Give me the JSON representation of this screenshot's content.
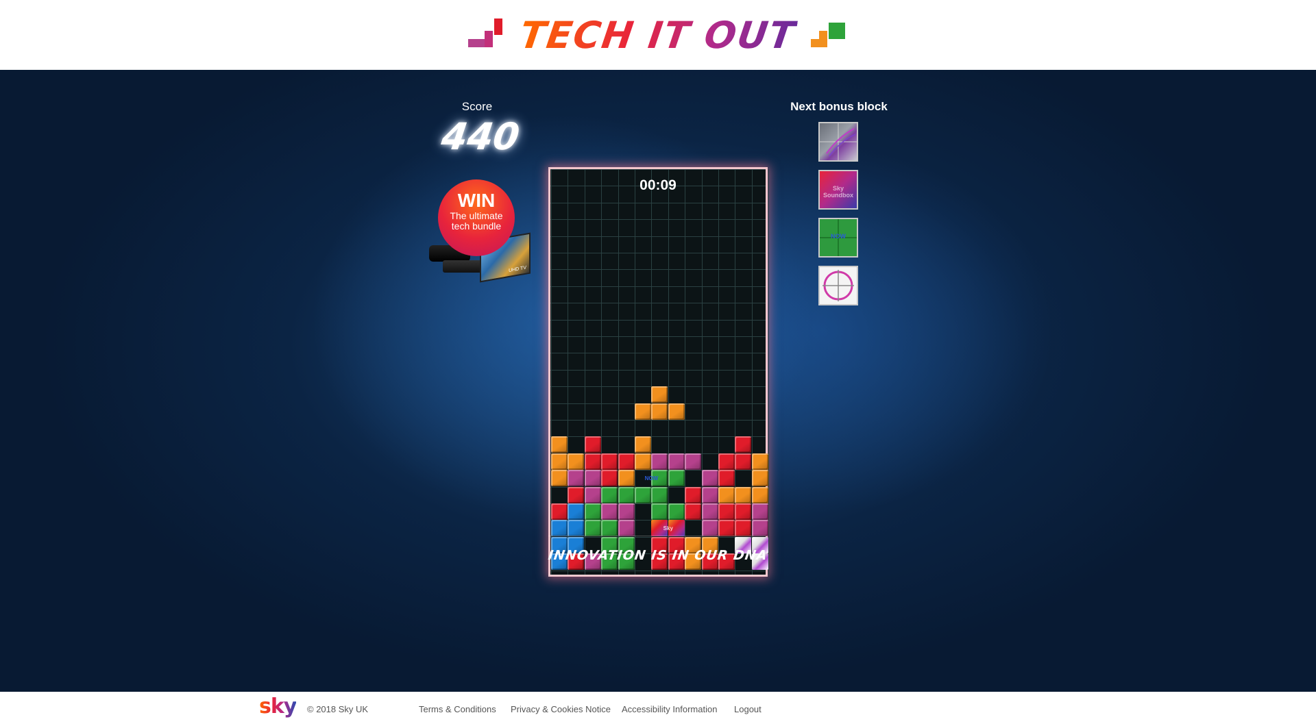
{
  "header": {
    "title": "TECH IT OUT"
  },
  "game": {
    "score_label": "Score",
    "score": "440",
    "timer": "00:09",
    "promo": {
      "headline": "WIN",
      "line1": "The ultimate",
      "line2": "tech bundle",
      "tv_label": "UHD TV"
    },
    "next_bonus_label": "Next bonus block",
    "tagline": "INNOVATION IS IN OUR DNA",
    "bonus_blocks": [
      {
        "name": "bonus-block-wireframe",
        "text": ""
      },
      {
        "name": "bonus-block-sky-soundbox",
        "text": "Sky Soundbox"
      },
      {
        "name": "bonus-block-now",
        "text": "NOW"
      },
      {
        "name": "bonus-block-target",
        "text": ""
      }
    ],
    "colors": {
      "O": "#f2901e",
      "R": "#e01c2a",
      "P": "#b5418c",
      "G": "#2ea33a",
      "B": "#1a7fd6",
      "W": "#dcdcdc",
      "X": "#d54b8a"
    },
    "cell_labels": {
      "now": "NOW",
      "sky": "Sky"
    },
    "rows": [
      ".............",
      ".............",
      ".............",
      ".............",
      ".............",
      ".............",
      ".............",
      ".............",
      ".............",
      ".............",
      ".............",
      ".............",
      "......O......",
      ".....OOO.....",
      ".............",
      "O.R..O.....R.",
      "OORRROPPP.RRO",
      "OPPRO.GG.PR.OO",
      ".RPGGGG.RPOOOO",
      "RBGPP.GGRPRRPP",
      "BBGGP.XX.PRRPP",
      "BB.GG.RROO.WW",
      "BRPGG.RRORR.WW"
    ]
  },
  "footer": {
    "brand": "sky",
    "copyright": "© 2018 Sky UK",
    "links": [
      "Terms & Conditions",
      "Privacy & Cookies Notice",
      "Accessibility Information",
      "Logout"
    ]
  }
}
